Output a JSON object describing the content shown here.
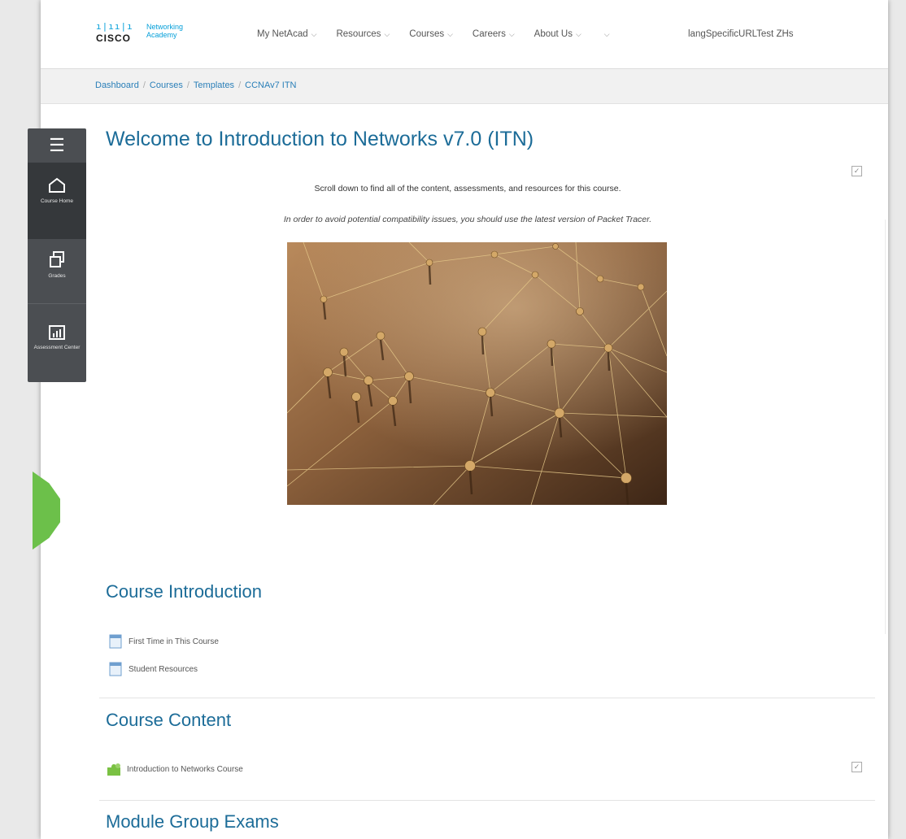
{
  "header": {
    "logo_cisco": "CISCO",
    "logo_bars": "ı|ıı|ı",
    "logo_networking": "Networking",
    "logo_academy": "Academy",
    "nav": [
      {
        "label": "My NetAcad"
      },
      {
        "label": "Resources"
      },
      {
        "label": "Courses"
      },
      {
        "label": "Careers"
      },
      {
        "label": "About Us"
      },
      {
        "label": ""
      }
    ],
    "lang_link": "langSpecificURLTest ZHs"
  },
  "breadcrumb": {
    "items": [
      "Dashboard",
      "Courses",
      "Templates",
      "CCNAv7 ITN"
    ],
    "separator": "/"
  },
  "sidenav": {
    "items": [
      {
        "label": "Course Home",
        "icon": "home-icon"
      },
      {
        "label": "Grades",
        "icon": "grades-icon"
      },
      {
        "label": "Assessment Center",
        "icon": "assessment-icon"
      }
    ]
  },
  "main": {
    "title": "Welcome to Introduction to Networks v7.0 (ITN)",
    "intro_line1": "Scroll down to find all of the content, assessments, and resources for this course.",
    "intro_line2": "In order to avoid potential compatibility issues, you should use the latest version of Packet Tracer.",
    "sections": [
      {
        "title": "Course Introduction",
        "links": [
          "First Time in This Course",
          "Student Resources"
        ]
      },
      {
        "title": "Course Content",
        "links": [
          "Introduction to Networks Course"
        ]
      },
      {
        "title": "Module Group Exams",
        "links": []
      }
    ]
  },
  "colors": {
    "accent_blue": "#1c6c98",
    "link_blue": "#2a7fb8",
    "sidenav_bg": "#4b4e52",
    "green": "#6cc04a"
  }
}
